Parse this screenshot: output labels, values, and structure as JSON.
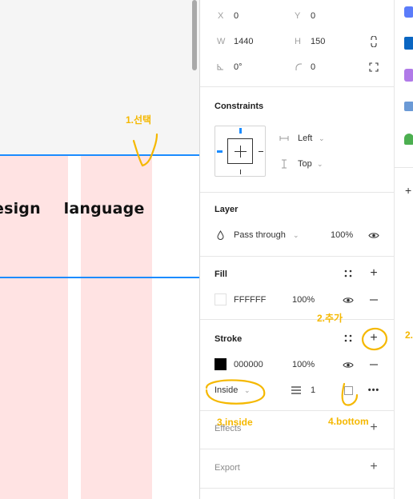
{
  "canvas": {
    "text_left": "esign",
    "text_right": "language"
  },
  "design": {
    "x_label": "X",
    "x_value": "0",
    "y_label": "Y",
    "y_value": "0",
    "w_label": "W",
    "w_value": "1440",
    "h_label": "H",
    "h_value": "150",
    "rotation_value": "0°",
    "radius_value": "0"
  },
  "constraints": {
    "title": "Constraints",
    "horizontal": "Left",
    "vertical": "Top"
  },
  "layer": {
    "title": "Layer",
    "blend_mode": "Pass through",
    "opacity": "100%"
  },
  "fill": {
    "title": "Fill",
    "hex": "FFFFFF",
    "opacity": "100%",
    "swatch_color": "#ffffff"
  },
  "stroke": {
    "title": "Stroke",
    "hex": "000000",
    "opacity": "100%",
    "swatch_color": "#000000",
    "position": "Inside",
    "weight": "1"
  },
  "effects": {
    "title": "Effects"
  },
  "export": {
    "title": "Export"
  },
  "annotations": {
    "step1": "1.선택",
    "step2": "2.추가",
    "step2_edge": "2.",
    "step3": "3.inside",
    "step4": "4.bottom"
  },
  "colors": {
    "accent": "#1b8cff",
    "annotation": "#f5b800",
    "grid_column": "#ffe3e3"
  }
}
